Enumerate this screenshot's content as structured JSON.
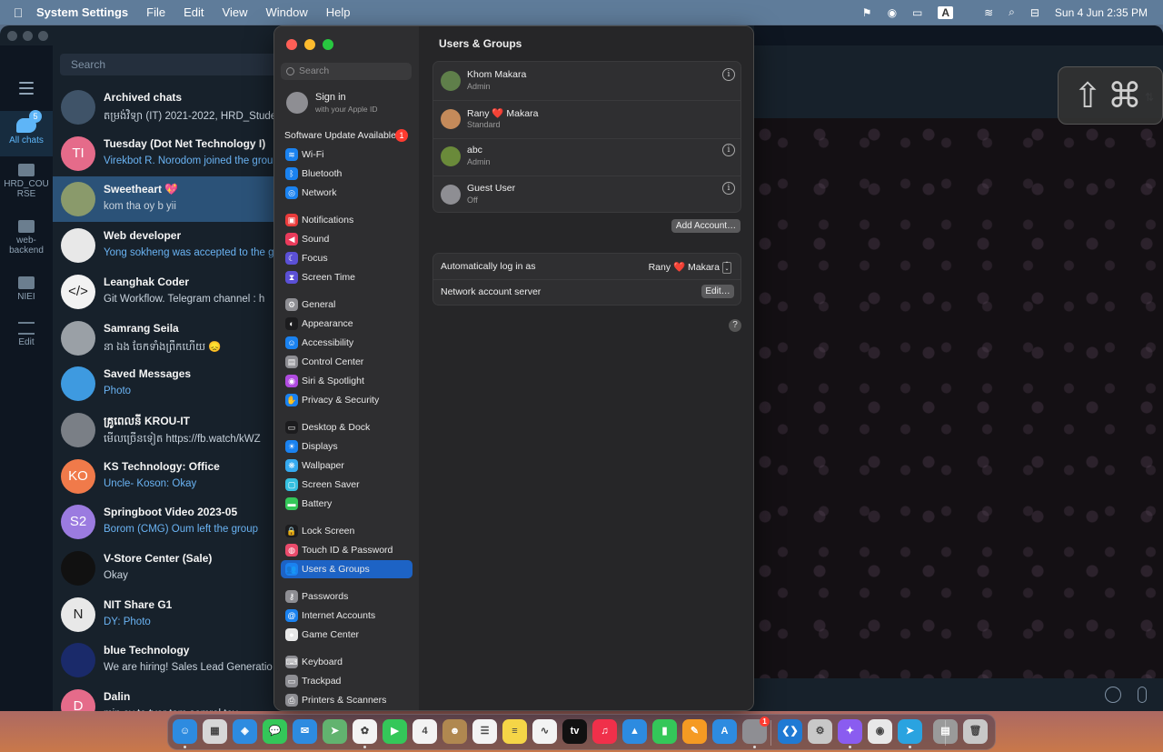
{
  "menubar": {
    "apple": "",
    "app_name": "System Settings",
    "items": [
      "File",
      "Edit",
      "View",
      "Window",
      "Help"
    ],
    "keyboard_badge": "A",
    "datetime": "Sun 4 Jun  2:35 PM"
  },
  "telegram": {
    "search_placeholder": "Search",
    "folders": [
      {
        "label": "All chats",
        "badge": "5"
      },
      {
        "label": "HRD_COURSE"
      },
      {
        "label": "web-backend"
      },
      {
        "label": "NIEI"
      },
      {
        "label": "Edit"
      }
    ],
    "chats": [
      {
        "name": "Archived chats",
        "message": "តម្រង់វិទ្យា (IT) 2021-2022, HRD_Student",
        "initials": "",
        "color": "#3f5368"
      },
      {
        "name": "Tuesday (Dot Net Technology I)",
        "message": "Virekbot R. Norodom joined the group",
        "initials": "TI",
        "color": "#e56b8a"
      },
      {
        "name": "Sweetheart 💖",
        "message": "kom tha oy b yii",
        "initials": "",
        "color": "#8a9a6b"
      },
      {
        "name": "Web developer",
        "message": "Yong sokheng was accepted to the group",
        "initials": "",
        "color": "#e8e8e8"
      },
      {
        "name": "Leanghak Coder",
        "message": "Git Workflow.  Telegram channel : h",
        "initials": "</>",
        "color": "#f2f2f2"
      },
      {
        "name": "Samrang Seila",
        "message": "នា ឯង ចែកទាំងព្រឹកហើយ 😞",
        "initials": "",
        "color": "#9aa0a6"
      },
      {
        "name": "Saved Messages",
        "message": "Photo",
        "initials": "",
        "color": "#3e9ae0"
      },
      {
        "name": "គ្រូពេលនី KROU-IT",
        "message": "មើលច្រើនទៀត  https://fb.watch/kWZ",
        "initials": "",
        "color": "#7a7f86"
      },
      {
        "name": "KS Technology: Office",
        "message": "Uncle- Koson: Okay",
        "initials": "KO",
        "color": "#f07a4a"
      },
      {
        "name": "Springboot Video 2023-05",
        "message": "Borom (CMG) Oum left the group",
        "initials": "S2",
        "color": "#9b7be0"
      },
      {
        "name": "V-Store Center (Sale)",
        "message": "Okay",
        "initials": "",
        "color": "#111111"
      },
      {
        "name": "NIT Share G1",
        "message": "DY:  Photo",
        "initials": "N",
        "color": "#e8e8e8"
      },
      {
        "name": "blue Technology",
        "message": "We are hiring! Sales Lead Generatio",
        "initials": "",
        "color": "#1a2a6a"
      },
      {
        "name": "Dalin",
        "message": "min ey te tver tam somrol toy",
        "initials": "D",
        "color": "#e56b8a"
      }
    ]
  },
  "settings": {
    "search_placeholder": "Search",
    "signin_title": "Sign in",
    "signin_sub": "with your Apple ID",
    "software_update": "Software Update Available",
    "software_update_badge": "1",
    "sidebar": [
      {
        "label": "Wi-Fi",
        "color": "#1a82f0",
        "glyph": "≋"
      },
      {
        "label": "Bluetooth",
        "color": "#1a82f0",
        "glyph": "ᛒ"
      },
      {
        "label": "Network",
        "color": "#1a82f0",
        "glyph": "◎"
      },
      {
        "label": "Notifications",
        "color": "#ea3b3b",
        "glyph": "▣"
      },
      {
        "label": "Sound",
        "color": "#ea3b5b",
        "glyph": "◀"
      },
      {
        "label": "Focus",
        "color": "#5b50d6",
        "glyph": "☾"
      },
      {
        "label": "Screen Time",
        "color": "#5b50d6",
        "glyph": "⧗"
      },
      {
        "label": "General",
        "color": "#8e8e93",
        "glyph": "⚙"
      },
      {
        "label": "Appearance",
        "color": "#1c1c1e",
        "glyph": "◐"
      },
      {
        "label": "Accessibility",
        "color": "#1a82f0",
        "glyph": "☺"
      },
      {
        "label": "Control Center",
        "color": "#8e8e93",
        "glyph": "▤"
      },
      {
        "label": "Siri & Spotlight",
        "color": "#b04be0",
        "glyph": "◉"
      },
      {
        "label": "Privacy & Security",
        "color": "#1a82f0",
        "glyph": "✋"
      },
      {
        "label": "Desktop & Dock",
        "color": "#1c1c1e",
        "glyph": "▭"
      },
      {
        "label": "Displays",
        "color": "#1a82f0",
        "glyph": "☀"
      },
      {
        "label": "Wallpaper",
        "color": "#35aaf0",
        "glyph": "❋"
      },
      {
        "label": "Screen Saver",
        "color": "#35c0e0",
        "glyph": "▢"
      },
      {
        "label": "Battery",
        "color": "#34c759",
        "glyph": "▬"
      },
      {
        "label": "Lock Screen",
        "color": "#1c1c1e",
        "glyph": "🔒"
      },
      {
        "label": "Touch ID & Password",
        "color": "#ea4b6b",
        "glyph": "◍"
      },
      {
        "label": "Users & Groups",
        "color": "#1a82f0",
        "glyph": "👥"
      },
      {
        "label": "Passwords",
        "color": "#8e8e93",
        "glyph": "⚷"
      },
      {
        "label": "Internet Accounts",
        "color": "#1a82f0",
        "glyph": "@"
      },
      {
        "label": "Game Center",
        "color": "#e8e8e8",
        "glyph": "●"
      },
      {
        "label": "Keyboard",
        "color": "#8e8e93",
        "glyph": "⌨"
      },
      {
        "label": "Trackpad",
        "color": "#8e8e93",
        "glyph": "▭"
      },
      {
        "label": "Printers & Scanners",
        "color": "#8e8e93",
        "glyph": "⎙"
      }
    ],
    "selected": "Users & Groups",
    "main": {
      "title": "Users & Groups",
      "users": [
        {
          "name": "Khom Makara",
          "role": "Admin",
          "avatar_color": "#5f7f4a",
          "info": true
        },
        {
          "name": "Rany ❤️ Makara",
          "role": "Standard",
          "avatar_color": "#c48a5a",
          "info": false
        },
        {
          "name": "abc",
          "role": "Admin",
          "avatar_color": "#6a8a3a",
          "info": true
        },
        {
          "name": "Guest User",
          "role": "Off",
          "avatar_color": "#8e8e93",
          "info": true
        }
      ],
      "add_account_button": "Add Account…",
      "auto_login_label": "Automatically log in as",
      "auto_login_value": "Rany ❤️ Makara",
      "network_server_label": "Network account server",
      "edit_button": "Edit…",
      "help": "?"
    }
  },
  "cmd_overlay": "⇧⌘",
  "dock": [
    {
      "name": "finder-icon",
      "color": "#2d8be0",
      "glyph": "☺"
    },
    {
      "name": "launchpad-icon",
      "color": "#d7d7d7",
      "glyph": "▦"
    },
    {
      "name": "safari-icon",
      "color": "#2d8be0",
      "glyph": "◈"
    },
    {
      "name": "messages-icon",
      "color": "#34c759",
      "glyph": "💬"
    },
    {
      "name": "mail-icon",
      "color": "#2d8be0",
      "glyph": "✉"
    },
    {
      "name": "maps-icon",
      "color": "#62b36f",
      "glyph": "➤"
    },
    {
      "name": "photos-icon",
      "color": "#f3f3f3",
      "glyph": "✿"
    },
    {
      "name": "facetime-icon",
      "color": "#34c759",
      "glyph": "▶"
    },
    {
      "name": "calendar-icon",
      "color": "#f3f3f3",
      "glyph": "4"
    },
    {
      "name": "contacts-icon",
      "color": "#b08850",
      "glyph": "☻"
    },
    {
      "name": "reminders-icon",
      "color": "#f3f3f3",
      "glyph": "☰"
    },
    {
      "name": "notes-icon",
      "color": "#f5d547",
      "glyph": "≡"
    },
    {
      "name": "freeform-icon",
      "color": "#f3f3f3",
      "glyph": "∿"
    },
    {
      "name": "appletv-icon",
      "color": "#111111",
      "glyph": "tv"
    },
    {
      "name": "music-icon",
      "color": "#f0304a",
      "glyph": "♫"
    },
    {
      "name": "keynote-icon",
      "color": "#2d8be0",
      "glyph": "▲"
    },
    {
      "name": "numbers-icon",
      "color": "#34c759",
      "glyph": "▮"
    },
    {
      "name": "pages-icon",
      "color": "#f59a23",
      "glyph": "✎"
    },
    {
      "name": "appstore-icon",
      "color": "#2d8be0",
      "glyph": "A"
    },
    {
      "name": "systemsettings-icon",
      "color": "#8e8e93",
      "glyph": "⚙",
      "badge": "1"
    },
    {
      "name": "vscode-icon",
      "color": "#1f7ad4",
      "glyph": "❮❯"
    },
    {
      "name": "preview-icon",
      "color": "#c8c8c8",
      "glyph": "⚙"
    },
    {
      "name": "messenger-icon",
      "color": "#8a5cf0",
      "glyph": "✦"
    },
    {
      "name": "chrome-icon",
      "color": "#e8e8e8",
      "glyph": "◉"
    },
    {
      "name": "telegram-icon",
      "color": "#2aa3e0",
      "glyph": "➤"
    },
    {
      "name": "downloads-icon",
      "color": "#9a9a9a",
      "glyph": "▤"
    },
    {
      "name": "trash-icon",
      "color": "#c8c8c8",
      "glyph": "🗑"
    }
  ],
  "dock_running": [
    0,
    6,
    19,
    22,
    24
  ]
}
